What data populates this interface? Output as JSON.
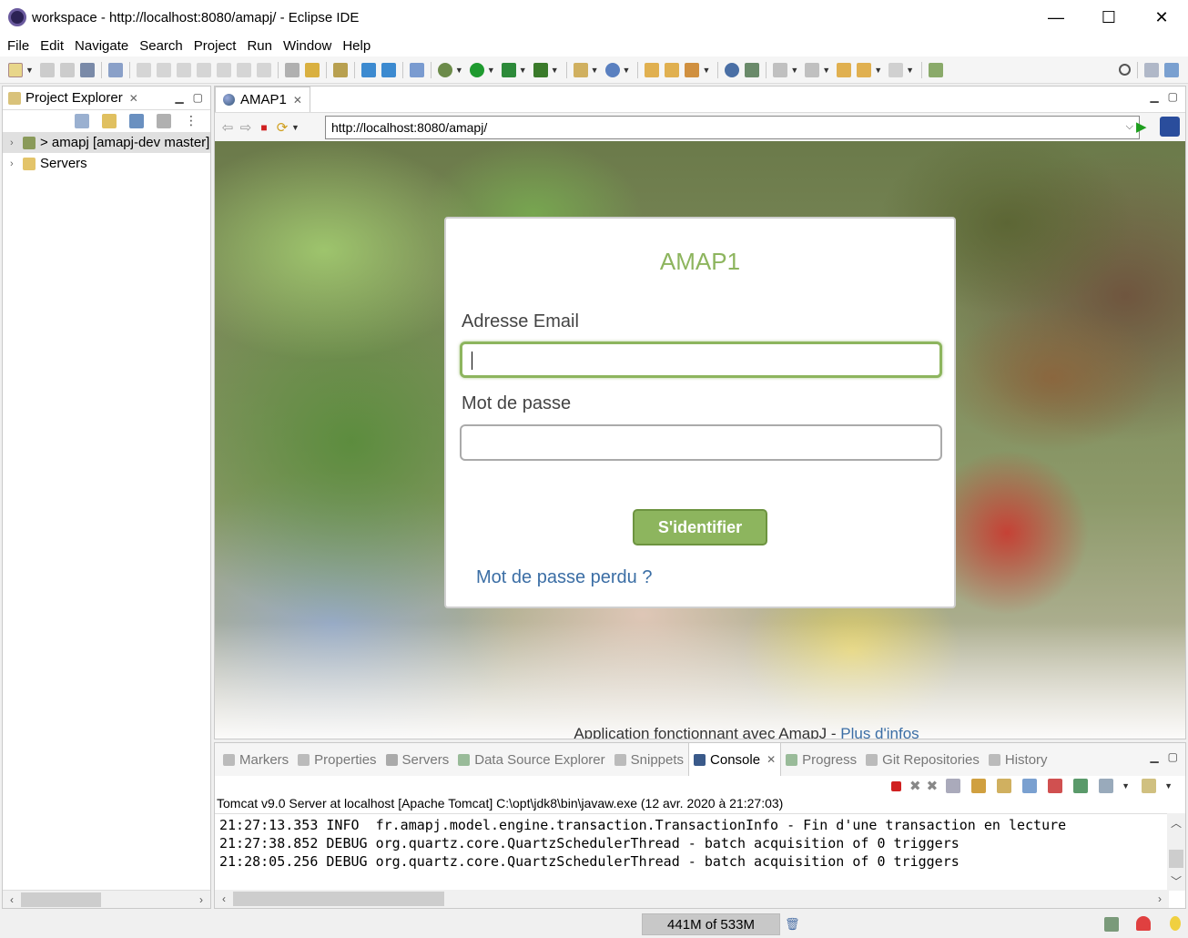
{
  "window": {
    "title": "workspace - http://localhost:8080/amapj/ - Eclipse IDE",
    "minimize": "—",
    "maximize": "☐",
    "close": "✕"
  },
  "menu": [
    "File",
    "Edit",
    "Navigate",
    "Search",
    "Project",
    "Run",
    "Window",
    "Help"
  ],
  "explorer": {
    "tab_label": "Project Explorer",
    "items": [
      {
        "label": "> amapj [amapj-dev master]",
        "selected": true
      },
      {
        "label": "Servers",
        "selected": false
      }
    ]
  },
  "browser": {
    "tab_label": "AMAP1",
    "url": "http://localhost:8080/amapj/"
  },
  "login": {
    "title": "AMAP1",
    "email_label": "Adresse Email",
    "email_value": "",
    "password_label": "Mot de passe",
    "password_value": "",
    "submit_label": "S'identifier",
    "forgot_link": "Mot de passe perdu ?",
    "footer_text": "Application fonctionnant avec AmapJ - ",
    "footer_link": "Plus d'infos"
  },
  "console": {
    "tabs": [
      "Markers",
      "Properties",
      "Servers",
      "Data Source Explorer",
      "Snippets",
      "Console",
      "Progress",
      "Git Repositories",
      "History"
    ],
    "active_tab": "Console",
    "description": "Tomcat v9.0 Server at localhost [Apache Tomcat] C:\\opt\\jdk8\\bin\\javaw.exe (12 avr. 2020 à 21:27:03)",
    "lines": [
      "21:27:13.353 INFO  fr.amapj.model.engine.transaction.TransactionInfo - Fin d'une transaction en lecture",
      "21:27:38.852 DEBUG org.quartz.core.QuartzSchedulerThread - batch acquisition of 0 triggers",
      "21:28:05.256 DEBUG org.quartz.core.QuartzSchedulerThread - batch acquisition of 0 triggers"
    ]
  },
  "status": {
    "heap": "441M of 533M"
  },
  "colors": {
    "accent_green": "#8db55e",
    "link_blue": "#3b6ea5"
  }
}
